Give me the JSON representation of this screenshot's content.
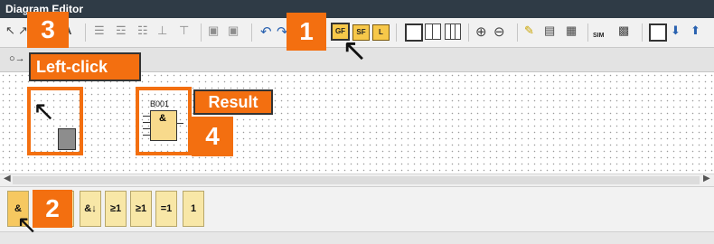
{
  "window": {
    "title": "Diagram Editor"
  },
  "toolbar": {
    "gf_label": "GF",
    "sf_label": "SF",
    "l_label": "L",
    "sim_label": "SIM",
    "text_tool_label": "A"
  },
  "tab": {
    "label": ""
  },
  "annotations": {
    "step1": "1",
    "step2": "2",
    "step3": "3",
    "step4": "4",
    "left_click": "Left-click",
    "result": "Result"
  },
  "canvas": {
    "block": {
      "name": "B001",
      "symbol": "&"
    }
  },
  "palette": {
    "items": [
      {
        "label": "&"
      },
      {
        "label": ""
      },
      {
        "label": "&↓"
      },
      {
        "label": "≥1"
      },
      {
        "label": "≥1"
      },
      {
        "label": "=1"
      },
      {
        "label": "1"
      }
    ]
  },
  "colors": {
    "accent": "#f36f10",
    "block_fill": "#f8da8c",
    "titlebar": "#2f3b46"
  }
}
